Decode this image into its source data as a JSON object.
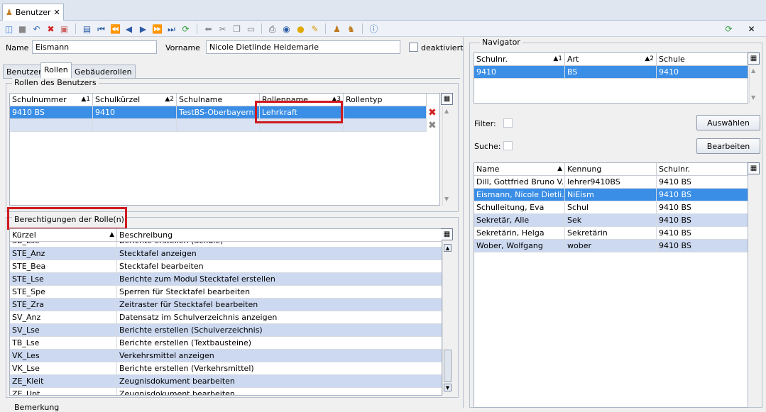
{
  "window": {
    "tab_label": "Benutzer"
  },
  "form": {
    "name_label": "Name",
    "name_value": "Eismann",
    "vorname_label": "Vorname",
    "vorname_value": "Nicole Dietlinde Heidemarie",
    "deaktiviert_label": "deaktiviert"
  },
  "tabs": [
    "Benutzer",
    "Rollen",
    "Gebäuderollen"
  ],
  "roles": {
    "title": "Rollen des Benutzers",
    "headers": [
      "Schulnummer",
      "Schulkürzel",
      "Schulname",
      "Rollenname",
      "Rollentyp"
    ],
    "sort_markers": [
      "1",
      "2",
      "3"
    ],
    "rows": [
      [
        "9410 BS",
        "9410",
        "TestBS-Oberbayern",
        "Lehrkraft",
        ""
      ]
    ]
  },
  "permissions": {
    "title": "Berechtigungen der Rolle(n)",
    "headers": [
      "Kürzel",
      "Beschreibung"
    ],
    "rows": [
      [
        "SB_Lse",
        "Berichte erstellen (Schule)"
      ],
      [
        "STE_Anz",
        "Stecktafel anzeigen"
      ],
      [
        "STE_Bea",
        "Stecktafel bearbeiten"
      ],
      [
        "STE_Lse",
        "Berichte zum Modul Stecktafel erstellen"
      ],
      [
        "STE_Spe",
        "Sperren für Stecktafel bearbeiten"
      ],
      [
        "STE_Zra",
        "Zeitraster für Stecktafel bearbeiten"
      ],
      [
        "SV_Anz",
        "Datensatz im Schulverzeichnis anzeigen"
      ],
      [
        "SV_Lse",
        "Berichte erstellen (Schulverzeichnis)"
      ],
      [
        "TB_Lse",
        "Berichte erstellen (Textbausteine)"
      ],
      [
        "VK_Les",
        "Verkehrsmittel anzeigen"
      ],
      [
        "VK_Lse",
        "Berichte erstellen (Verkehrsmittel)"
      ],
      [
        "ZE_Kleit",
        "Zeugnisdokument bearbeiten"
      ],
      [
        "ZE_Upt",
        "Zeugnisdokument bearbeiten"
      ]
    ]
  },
  "bemerkung_label": "Bemerkung",
  "navigator": {
    "title": "Navigator",
    "headers": [
      "Schulnr.",
      "Art",
      "Schule"
    ],
    "sort_markers": [
      "1",
      "2"
    ],
    "rows": [
      [
        "9410",
        "BS",
        "9410"
      ]
    ],
    "filter_label": "Filter:",
    "suche_label": "Suche:",
    "auswaehlen_button": "Auswählen",
    "bearbeiten_button": "Bearbeiten",
    "user_headers": [
      "Name",
      "Kennung",
      "Schulnr."
    ],
    "users": [
      [
        "Dill, Gottfried Bruno V...",
        "lehrer9410BS",
        "9410 BS"
      ],
      [
        "Eismann, Nicole Dietli...",
        "NiEism",
        "9410 BS"
      ],
      [
        "Schulleitung, Eva",
        "Schul",
        "9410 BS"
      ],
      [
        "Sekretär, Alle",
        "Sek",
        "9410 BS"
      ],
      [
        "Sekretärin, Helga",
        "Sekretärin",
        "9410 BS"
      ],
      [
        "Wober, Wolfgang",
        "wober",
        "9410 BS"
      ]
    ]
  },
  "colors": {
    "selection": "#3a8ee6",
    "alt_row": "#ccd9f0",
    "highlight": "#d0191f"
  }
}
